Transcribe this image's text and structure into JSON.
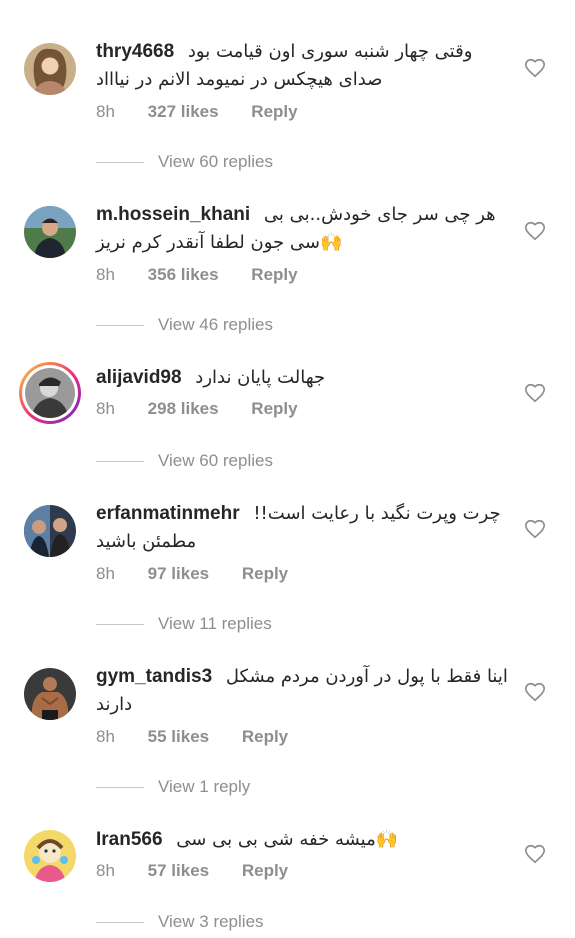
{
  "comments": [
    {
      "username": "thry4668",
      "lines": [
        "وقتی چهار شنبه سوری اون قیامت بود",
        "صدای هیچکس در نمیومد الانم در نیاااد"
      ],
      "time": "8h",
      "likes": "327 likes",
      "reply": "Reply",
      "view_replies": "View 60 replies",
      "avatar_icon": "woman-portrait",
      "has_story": false
    },
    {
      "username": "m.hossein_khani",
      "lines": [
        "هر چی سر جای خودش..بی بی",
        "🙌سی جون لطفا آنقدر کرم نریز"
      ],
      "time": "8h",
      "likes": "356 likes",
      "reply": "Reply",
      "view_replies": "View 46 replies",
      "avatar_icon": "man-outdoors-portrait",
      "has_story": false
    },
    {
      "username": "alijavid98",
      "lines": [
        "جهالت پایان ندارد"
      ],
      "time": "8h",
      "likes": "298 likes",
      "reply": "Reply",
      "view_replies": "View 60 replies",
      "avatar_icon": "man-bw-portrait",
      "has_story": true
    },
    {
      "username": "erfanmatinmehr",
      "lines": [
        "چرت وپرت نگید با رعایت است!!",
        "مطمئن باشید"
      ],
      "time": "8h",
      "likes": "97 likes",
      "reply": "Reply",
      "view_replies": "View 11 replies",
      "avatar_icon": "two-men-portrait",
      "has_story": false
    },
    {
      "username": "gym_tandis3",
      "lines": [
        "اینا فقط با پول در آوردن مردم مشکل",
        "دارند"
      ],
      "time": "8h",
      "likes": "55 likes",
      "reply": "Reply",
      "view_replies": "View 1 reply",
      "avatar_icon": "bodybuilder-portrait",
      "has_story": false
    },
    {
      "username": "Iran566",
      "lines": [
        "🙌میشه خفه شی بی بی سی"
      ],
      "time": "8h",
      "likes": "57 likes",
      "reply": "Reply",
      "view_replies": "View 3 replies",
      "avatar_icon": "cartoon-avatar",
      "has_story": false
    }
  ],
  "colors": {
    "text": "#262626",
    "secondary": "#8e8e8e",
    "divider": "#c7c7c7",
    "background": "#ffffff"
  }
}
